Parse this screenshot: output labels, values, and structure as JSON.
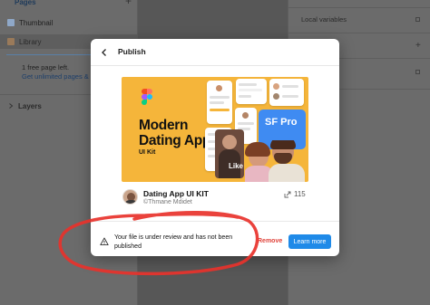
{
  "left_panel": {
    "pages_header": "Pages",
    "pages": [
      {
        "label": "Thumbnail"
      },
      {
        "label": "Library"
      }
    ],
    "upgrade": {
      "line1": "1 free page left.",
      "line2": "Get unlimited pages & r"
    },
    "layers_label": "Layers"
  },
  "right_panel": {
    "local_variables_label": "Local variables"
  },
  "modal": {
    "title": "Publish",
    "thumbnail": {
      "hero_title_line1": "Modern",
      "hero_title_line2": "Dating App",
      "hero_subtitle": "UI Kit",
      "badge_text": "SF Pro",
      "like_text": "Like"
    },
    "file": {
      "name": "Dating App UI KIT",
      "author": "©Thmane Mdidet",
      "duplicates": "115"
    },
    "review_message": "Your file is under review and has not been published",
    "remove_label": "Remove",
    "learn_more_label": "Learn more"
  },
  "colors": {
    "accent_blue": "#1f8ae8",
    "danger_red": "#e0433b",
    "thumbnail_bg": "#f5b53a",
    "annotation_red": "#e8322b"
  },
  "icons": [
    "back-arrow-icon",
    "warning-icon",
    "duplicate-icon",
    "plus-icon",
    "figma-logo-icon"
  ]
}
